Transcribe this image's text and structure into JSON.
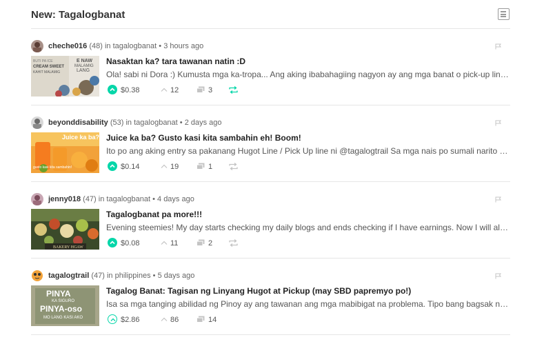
{
  "header": {
    "title": "New: Tagalogbanat",
    "view_toggle_icon": "list-view-icon"
  },
  "colors": {
    "accent": "#06d6a9",
    "muted_icon": "#c4c4c4",
    "border": "#e6e6e6"
  },
  "posts": [
    {
      "author": "cheche016",
      "reputation": "(48)",
      "in_label": "in",
      "community": "tagalogbanat",
      "separator": "•",
      "time": "3 hours ago",
      "title": "Nasaktan ka? tara tawanan natin :D",
      "excerpt": "Ola! sabi ni Dora :) Kumusta mga ka-tropa... Ang aking ibabahagiing nagyon ay ang mga banat o pick-up lines na sigurado akong makakapagpangiti sa inyo",
      "payout": "$0.38",
      "votes": "12",
      "comments": "3",
      "upvoted": true,
      "resteemed": true,
      "thumb_text": [
        "E NAW",
        "MALAMIG",
        "LANG",
        "BUTI PA ICE",
        "CREAM SWEET",
        "KAHIT MALAMIG"
      ]
    },
    {
      "author": "beyonddisability",
      "reputation": "(53)",
      "in_label": "in",
      "community": "tagalogbanat",
      "separator": "•",
      "time": "2 days ago",
      "title": "Juice ka ba? Gusto kasi kita sambahin eh! Boom!",
      "excerpt": "Ito po ang aking entry sa pakanang Hugot Line / Pick Up line ni @tagalogtrail Sa mga nais po sumali narito ang link",
      "payout": "$0.14",
      "votes": "19",
      "comments": "1",
      "upvoted": true,
      "resteemed": false,
      "thumb_text": [
        "Juice ka ba?",
        "gusto kasi kita sambahin!"
      ]
    },
    {
      "author": "jenny018",
      "reputation": "(47)",
      "in_label": "in",
      "community": "tagalogbanat",
      "separator": "•",
      "time": "4 days ago",
      "title": "Tagalogbanat pa more!!!",
      "excerpt": "Evening steemies! My day starts checking my daily blogs and ends checking if I have earnings. Now I will also start to share some",
      "payout": "$0.08",
      "votes": "11",
      "comments": "2",
      "upvoted": true,
      "resteemed": false,
      "thumb_text": [
        "BAKERY HGAW"
      ]
    },
    {
      "author": "tagalogtrail",
      "reputation": "(47)",
      "in_label": "in",
      "community": "philippines",
      "separator": "•",
      "time": "5 days ago",
      "title": "Tagalog Banat: Tagisan ng Linyang Hugot at Pickup (may SBD papremyo po!)",
      "excerpt": "Isa sa mga tanging abilidad ng Pinoy ay ang tawanan ang mga mabibigat na problema. Tipo bang bagsak na nga, nakangiti pa rin",
      "payout": "$2.86",
      "votes": "86",
      "comments": "14",
      "upvoted": false,
      "resteemed": false,
      "thumb_text": [
        "PINYA",
        "KA SIGURO",
        "PINYA-oso",
        "MO LANG KASI AKO"
      ]
    }
  ]
}
